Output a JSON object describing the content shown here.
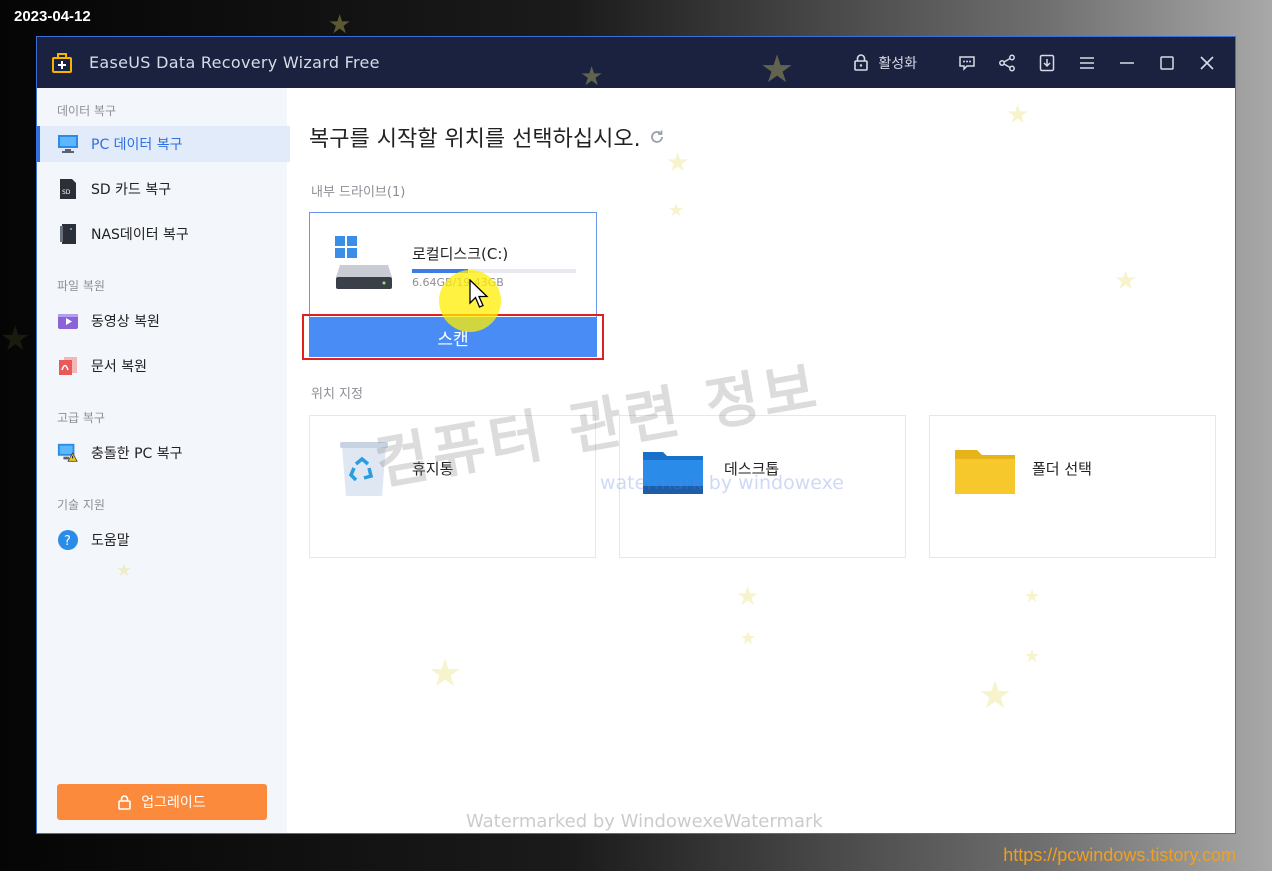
{
  "overlay": {
    "date": "2023-04-12",
    "site_url": "https://pcwindows.tistory.com",
    "watermark_main": "컴퓨터 관련 정보",
    "watermark_sub": "watermark by windowexe",
    "watermark_bottom": "Watermarked by WindowexeWatermark"
  },
  "titlebar": {
    "title": "EaseUS Data Recovery Wizard Free",
    "activate_label": "활성화",
    "icons": [
      "lock-icon",
      "feedback-icon",
      "share-icon",
      "download-icon",
      "menu-icon",
      "minimize-icon",
      "maximize-icon",
      "close-icon"
    ]
  },
  "sidebar": {
    "sections": [
      {
        "label": "데이터 복구"
      },
      {
        "label": "파일 복원"
      },
      {
        "label": "고급 복구"
      },
      {
        "label": "기술 지원"
      }
    ],
    "items": [
      {
        "label": "PC 데이터 복구",
        "icon": "monitor-icon",
        "active": true
      },
      {
        "label": "SD 카드 복구",
        "icon": "sd-card-icon"
      },
      {
        "label": "NAS데이터 복구",
        "icon": "nas-icon"
      },
      {
        "label": "동영상 복원",
        "icon": "video-icon"
      },
      {
        "label": "문서 복원",
        "icon": "document-icon"
      },
      {
        "label": "충돌한 PC 복구",
        "icon": "crashed-pc-icon"
      },
      {
        "label": "도움말",
        "icon": "help-icon"
      }
    ],
    "upgrade_label": "업그레이드",
    "accent_color": "#2f6fe0",
    "upgrade_color": "#fb8a3c"
  },
  "main": {
    "title": "복구를 시작할 위치를 선택하십시오.",
    "internal_drives_label": "내부 드라이브(1)",
    "drive": {
      "name": "로컬디스크(C:)",
      "size_text": "6.64GB/19.43GB",
      "used_fraction": 0.34,
      "scan_label": "스캔"
    },
    "location_label": "위치 지정",
    "locations": [
      {
        "label": "휴지통",
        "icon": "recycle-bin-icon"
      },
      {
        "label": "데스크톱",
        "icon": "desktop-folder-icon"
      },
      {
        "label": "폴더 선택",
        "icon": "folder-icon"
      }
    ]
  }
}
